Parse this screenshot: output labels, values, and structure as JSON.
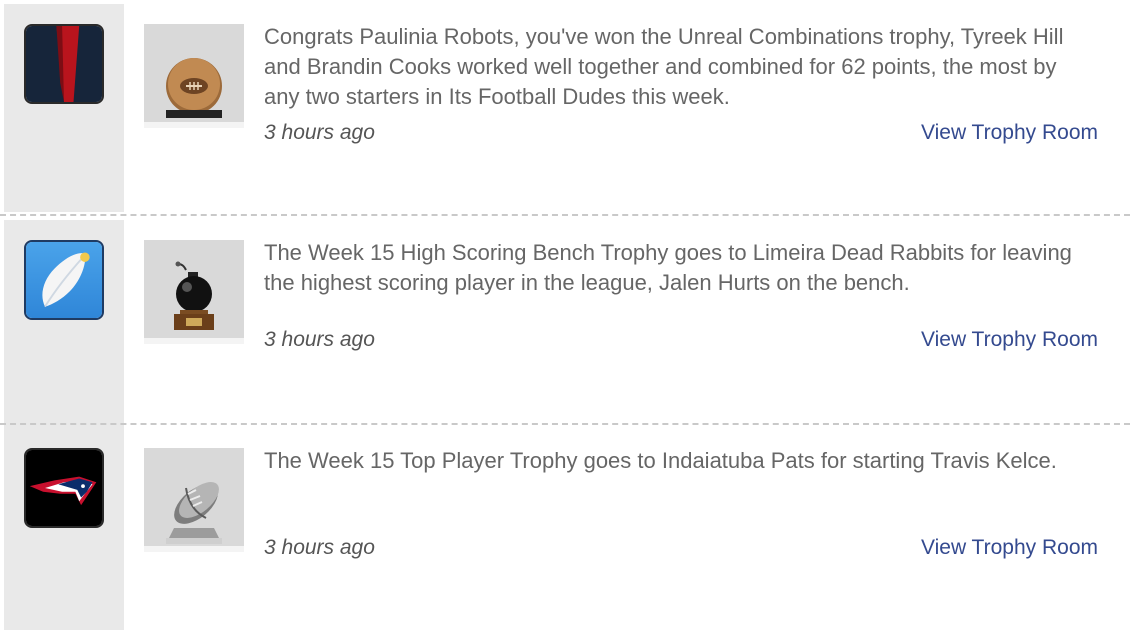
{
  "feed": {
    "items": [
      {
        "team_logo_icon": "red-stripe-team-logo",
        "trophy_icon": "football-trophy-icon",
        "message": "Congrats Paulinia Robots, you've won the Unreal Combinations trophy, Tyreek Hill and Brandin Cooks worked well together and combined for 62 points, the most by any two starters in Its Football Dudes this week.",
        "timestamp": "3 hours ago",
        "link_label": "View Trophy Room"
      },
      {
        "team_logo_icon": "feather-team-logo",
        "trophy_icon": "bomb-trophy-icon",
        "message": "The Week 15 High Scoring Bench Trophy goes to Limeira Dead Rabbits for leaving the highest scoring player in the league, Jalen Hurts on the bench.",
        "timestamp": "3 hours ago",
        "link_label": "View Trophy Room"
      },
      {
        "team_logo_icon": "patriots-team-logo",
        "trophy_icon": "silver-football-trophy-icon",
        "message": "The Week 15 Top Player Trophy goes to Indaiatuba Pats for starting Travis Kelce.",
        "timestamp": "3 hours ago",
        "link_label": "View Trophy Room"
      }
    ]
  },
  "colors": {
    "link": "#344a8f",
    "text": "#666666",
    "left_column_bg": "#e9e9e9"
  }
}
